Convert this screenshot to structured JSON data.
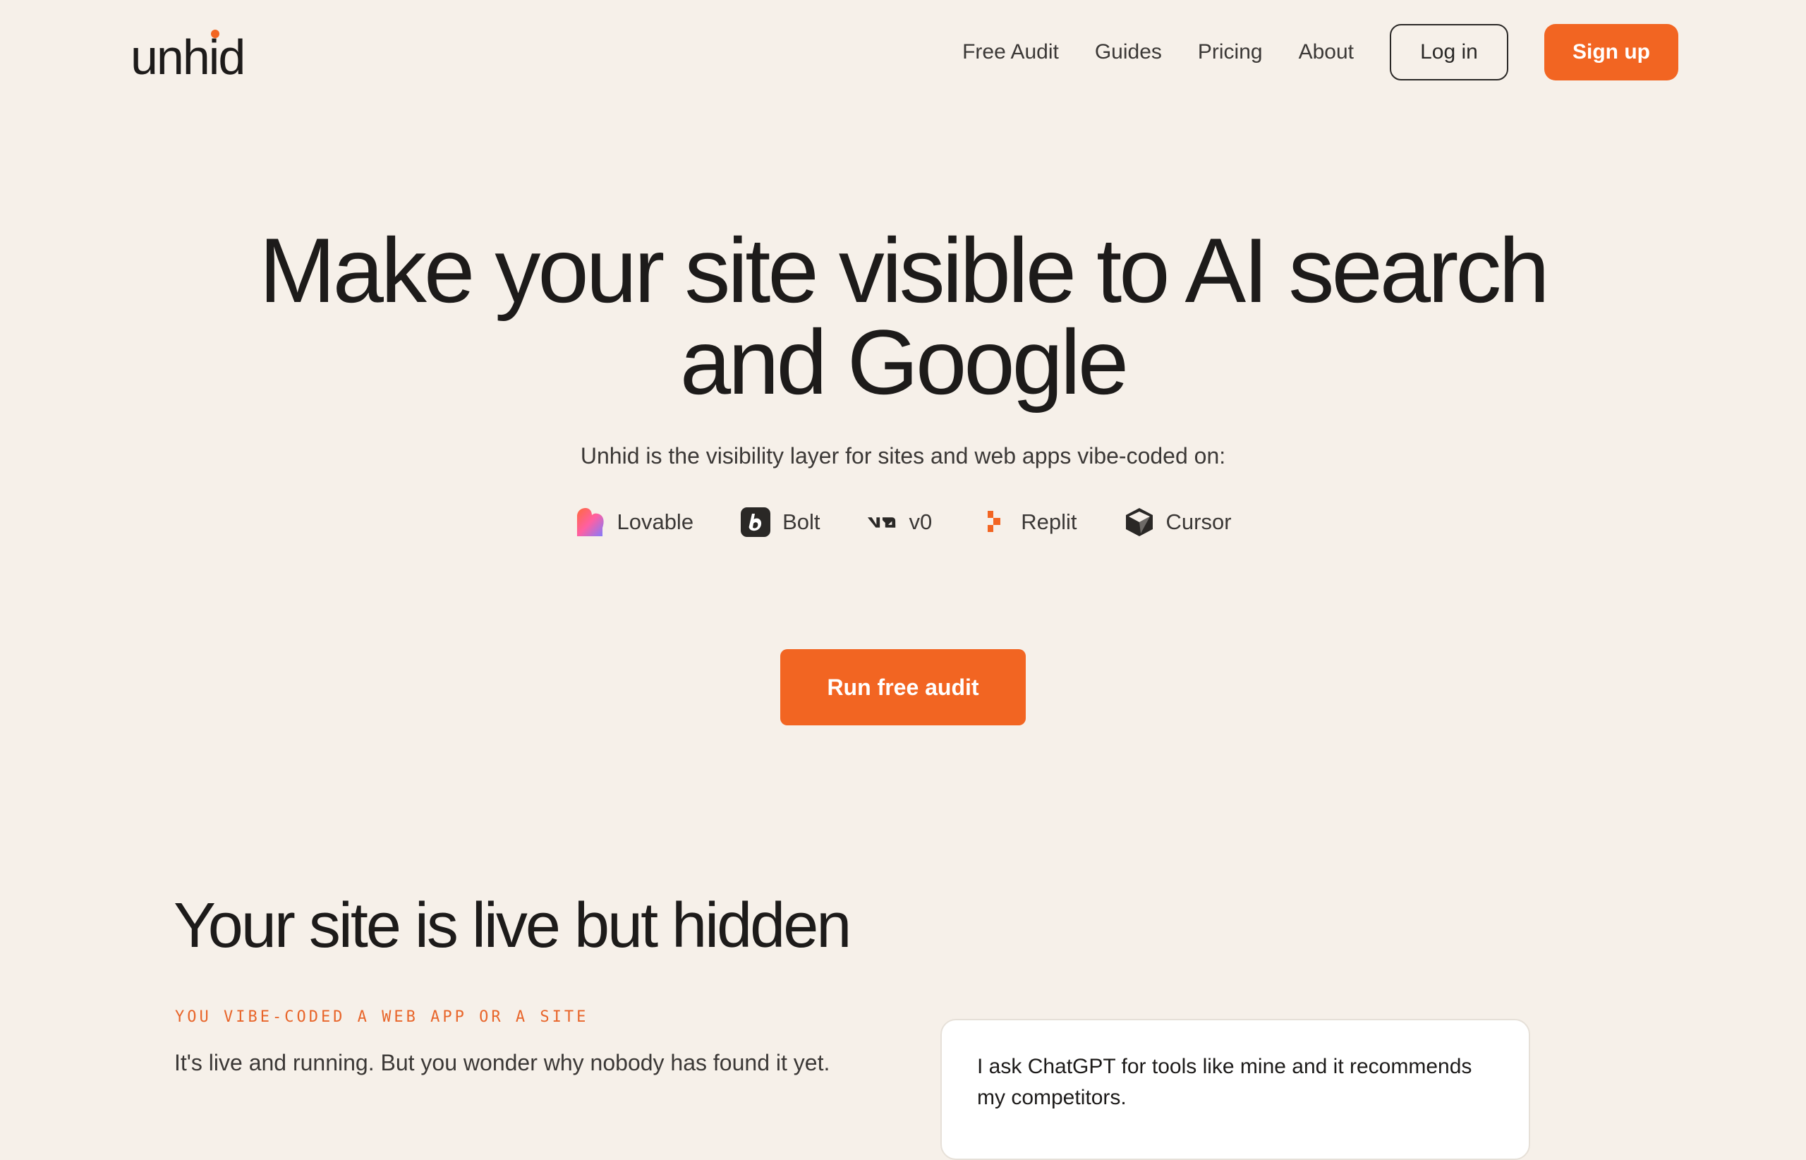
{
  "header": {
    "logo_text": "unhid",
    "nav": [
      "Free Audit",
      "Guides",
      "Pricing",
      "About"
    ],
    "login_label": "Log in",
    "signup_label": "Sign up"
  },
  "hero": {
    "title_line1": "Make your site visible to AI search",
    "title_line2": "and Google",
    "subtitle": "Unhid is the visibility layer for sites and web apps vibe-coded on:",
    "platforms": [
      {
        "label": "Lovable",
        "icon": "lovable-heart-icon"
      },
      {
        "label": "Bolt",
        "icon": "bolt-icon"
      },
      {
        "label": "v0",
        "icon": "v0-icon"
      },
      {
        "label": "Replit",
        "icon": "replit-icon"
      },
      {
        "label": "Cursor",
        "icon": "cursor-cube-icon"
      }
    ],
    "cta_label": "Run free audit"
  },
  "section": {
    "title": "Your site is live but hidden",
    "eyebrow": "YOU VIBE-CODED A WEB APP OR A SITE",
    "body": "It's live and running. But you wonder why nobody has found it yet.",
    "quote": "I ask ChatGPT for tools like mine and it recommends my competitors."
  },
  "colors": {
    "background": "#f6f0e9",
    "accent": "#f26522",
    "text": "#1d1b1a"
  }
}
